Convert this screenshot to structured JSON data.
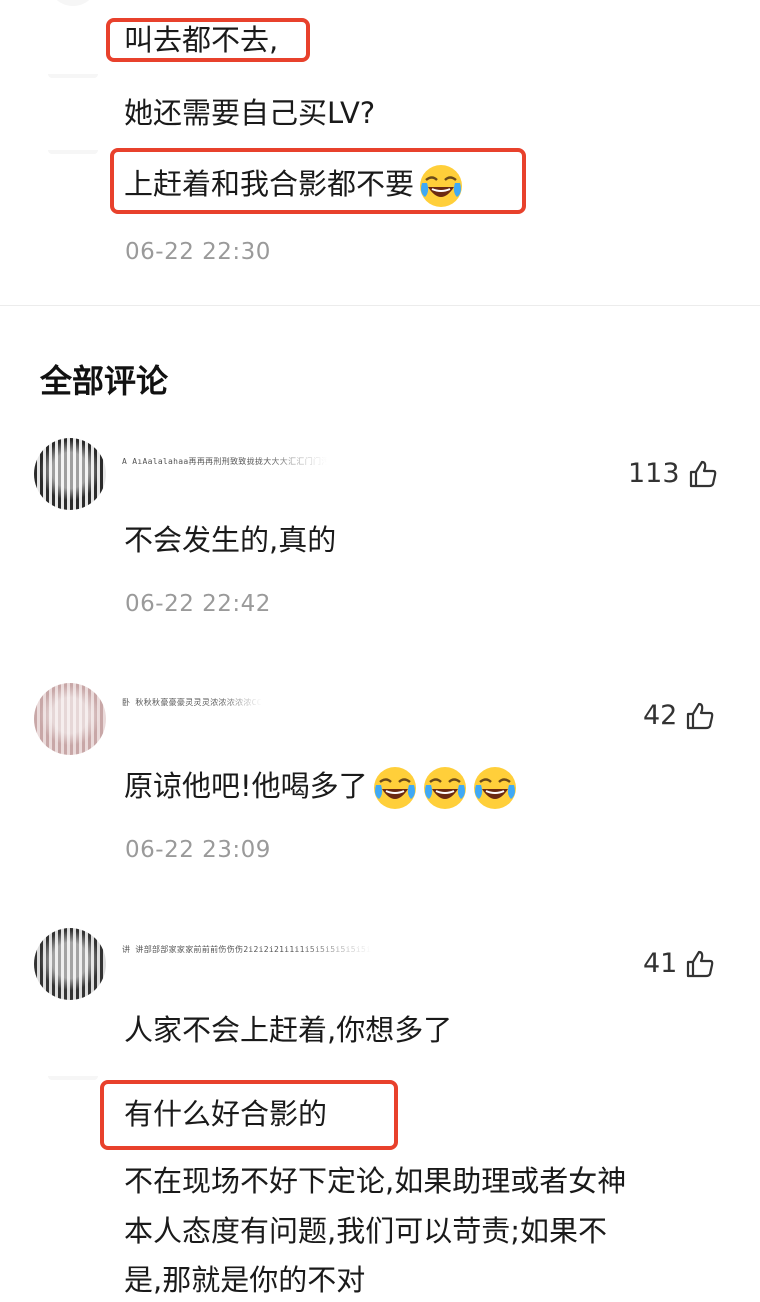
{
  "reply_thread": {
    "lines": [
      "叫去都不去,",
      "她还需要自己买LV?",
      "上赶着和我合影都不要"
    ],
    "timestamp": "06-22 22:30"
  },
  "section": {
    "title": "全部评论"
  },
  "comments": [
    {
      "masked_name": "A AıAalalahaa再再再刑刑致致拢拢大大大汇汇门门汚汚牙牙子 F A AıAalalahaa再再再刑刑致致拢拢大大大汇汇门门汚汚牙牙子 F",
      "likes": "113",
      "text": "不会发生的,真的",
      "timestamp": "06-22 22:42"
    },
    {
      "masked_name": "卧 秋秋秋豪豪豪灵灵灵浓浓浓浓浓CCCCCCC 卧 秋秋秋豪豪豪灵灵灵浓浓浓浓浓CCCCCCC 卧 秋秋秋豪豪豪灵灵灵浓浓浓浓浓CCCCCCC",
      "likes": "42",
      "text": "原谅他吧!他喝多了",
      "timestamp": "06-22 23:09"
    },
    {
      "masked_name": "讲 讲部部部家家家前前前伤伤伤2i2i2i21i1i1i5i5i5i5i5i5i5i9i9i9i9i9i9i9i8i8i9i9i 讲 讲部部部家家家前前前伤伤伤2i2i2i21i1i1i5i5i5i5i5i5i9i9i9i9i9i9i9i9i8i8i9i9i",
      "likes": "41",
      "text": "人家不会上赶着,你想多了",
      "quote": "有什么好合影的",
      "extra_lines": [
        "不在现场不好下定论,如果助理或者女神",
        "本人态度有问题,我们可以苛责;如果不",
        "是,那就是你的不对"
      ]
    }
  ],
  "icons": {
    "like": "thumbs-up-icon",
    "emoji": "crying-laughing-emoji-icon"
  },
  "colors": {
    "highlight_box": "#e8412c",
    "timestamp": "#9a9a9a"
  }
}
